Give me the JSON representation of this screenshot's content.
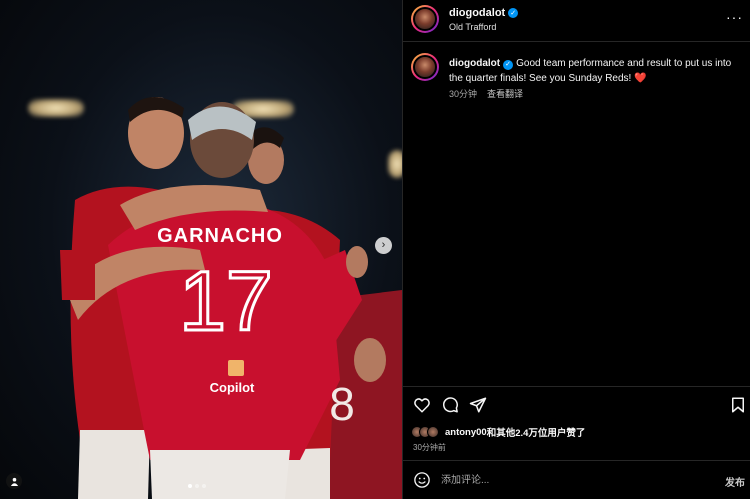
{
  "post": {
    "username": "diogodalot",
    "location": "Old Trafford",
    "caption": "Good team performance and result to put us into the quarter finals! See you Sunday Reds!",
    "caption_emoji": "❤️",
    "caption_time": "30分钟",
    "translate_label": "查看翻译",
    "likes_prefix_user": "antony00",
    "likes_text": "和其他2.4万位用户赞了",
    "posted_time": "30分钟前"
  },
  "media": {
    "jersey_name": "GARNACHO",
    "jersey_number": "17",
    "sponsor_text": "Copilot",
    "background_number": "8",
    "carousel_total": 3,
    "carousel_active": 1
  },
  "comment": {
    "placeholder": "添加评论...",
    "post_label": "发布"
  },
  "icons": {
    "more": "more-options-icon",
    "next": "chevron-right-icon",
    "tag": "user-tag-icon",
    "like": "heart-icon",
    "comment": "comment-icon",
    "share": "share-icon",
    "save": "bookmark-icon",
    "emoji": "emoji-icon"
  },
  "colors": {
    "verified": "#0095f6",
    "background": "#000000",
    "divider": "#262626",
    "jersey_red": "#c8102e"
  }
}
